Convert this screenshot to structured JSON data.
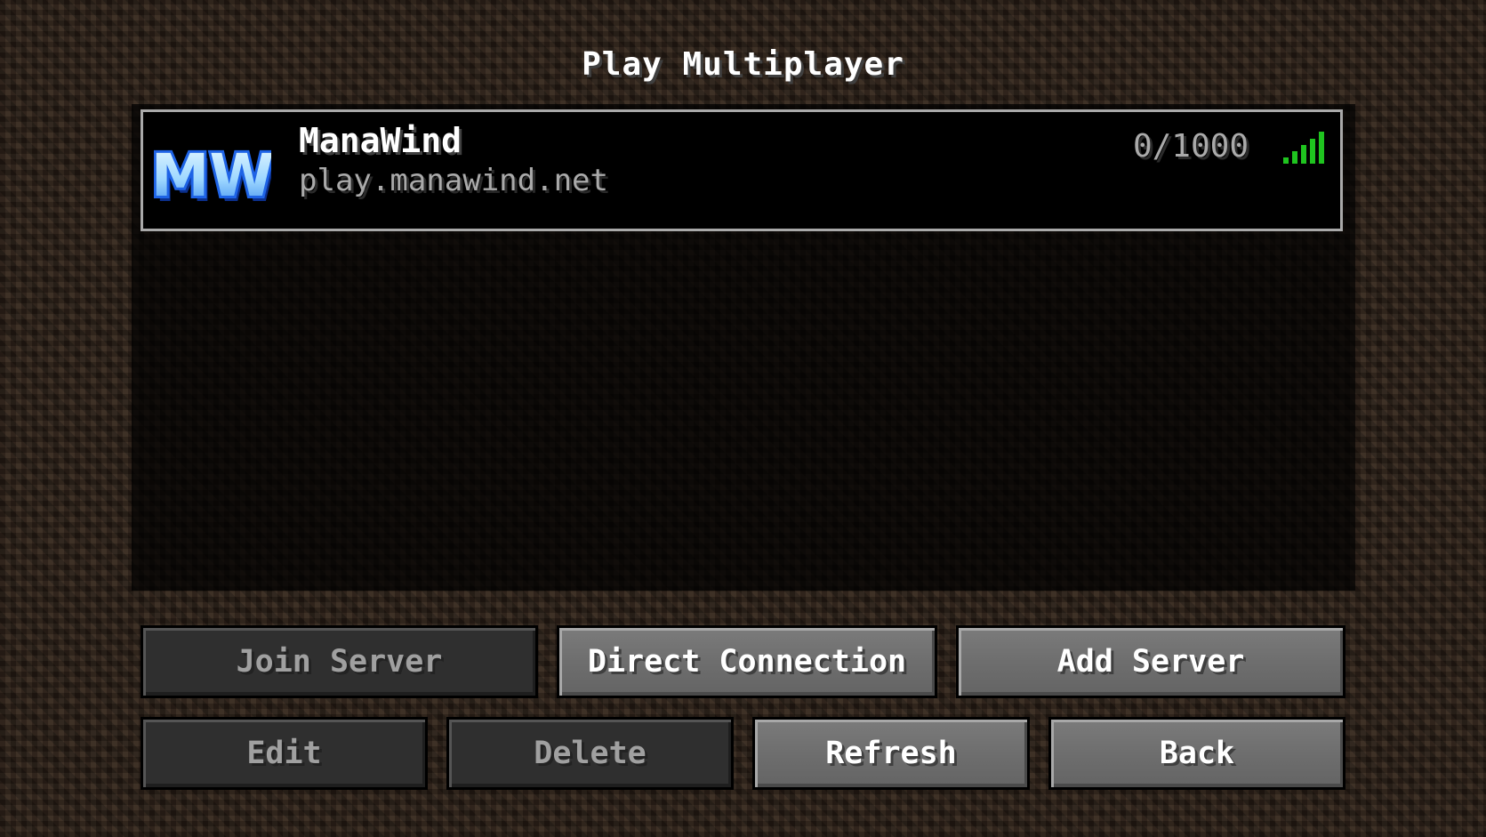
{
  "screen": {
    "title": "Play Multiplayer"
  },
  "servers": [
    {
      "name": "ManaWind",
      "address": "play.manawind.net",
      "player_count": "0/1000",
      "icon": "manawind-logo-icon",
      "icon_text": "MW",
      "ping_bars": 5,
      "selected": true
    }
  ],
  "buttons": {
    "join_server": "Join Server",
    "direct_connection": "Direct Connection",
    "add_server": "Add Server",
    "edit": "Edit",
    "delete": "Delete",
    "refresh": "Refresh",
    "back": "Back"
  },
  "colors": {
    "signal_green": "#1fc41f",
    "icon_blue": "#1e63e6",
    "icon_light": "#cfeeff",
    "address_gray": "#aaaaaa"
  }
}
